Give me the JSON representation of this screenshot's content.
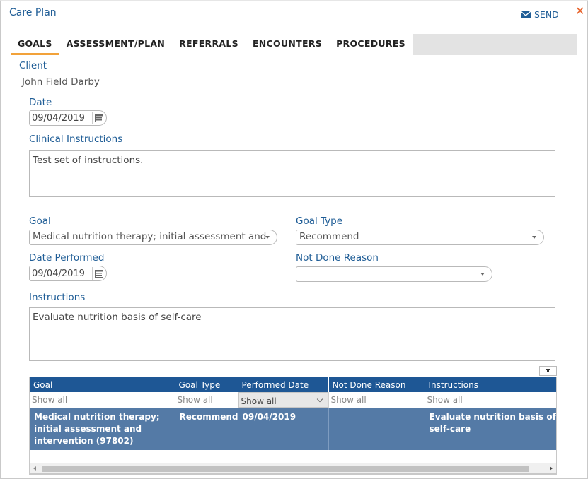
{
  "window": {
    "title": "Care Plan",
    "send_label": "SEND",
    "close_glyph": "✕"
  },
  "tabs": [
    {
      "label": "GOALS",
      "active": true
    },
    {
      "label": "ASSESSMENT/PLAN",
      "active": false
    },
    {
      "label": "REFERRALS",
      "active": false
    },
    {
      "label": "ENCOUNTERS",
      "active": false
    },
    {
      "label": "PROCEDURES",
      "active": false
    }
  ],
  "form": {
    "client_label": "Client",
    "client_value": "John Field Darby",
    "date_label": "Date",
    "date_value": "09/04/2019",
    "clinical_label": "Clinical Instructions",
    "clinical_value": "Test set of instructions.",
    "goal_label": "Goal",
    "goal_value": "Medical nutrition therapy; initial assessment and",
    "goal_type_label": "Goal Type",
    "goal_type_value": "Recommend",
    "date_performed_label": "Date Performed",
    "date_performed_value": "09/04/2019",
    "not_done_label": "Not Done Reason",
    "not_done_value": "",
    "instructions_label": "Instructions",
    "instructions_value": "Evaluate nutrition basis of self-care"
  },
  "grid": {
    "columns": [
      "Goal",
      "Goal Type",
      "Performed Date",
      "Not Done Reason",
      "Instructions"
    ],
    "filter_placeholder": "Show all",
    "filter_selected": "Show all",
    "rows": [
      {
        "goal": "Medical nutrition therapy; initial assessment and intervention (97802)",
        "goal_type": "Recommend",
        "performed_date": "09/04/2019",
        "not_done_reason": "",
        "instructions": "Evaluate nutrition basis of self-care"
      }
    ]
  },
  "colors": {
    "accent": "#1f5d96",
    "tab_indicator": "#f2a23a",
    "grid_header": "#1e5795",
    "selected_row": "#547aa6",
    "close": "#e8632b"
  }
}
